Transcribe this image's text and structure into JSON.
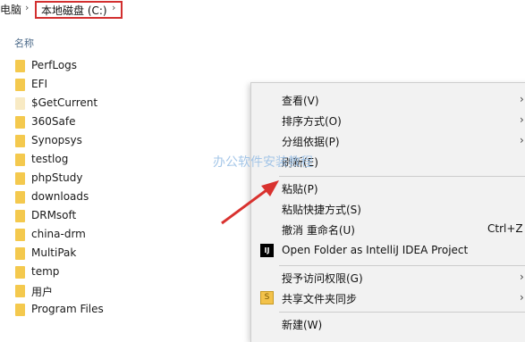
{
  "breadcrumb": {
    "root_label": "电脑",
    "sep1": "›",
    "current_label": "本地磁盘 (C:)",
    "sep2": "›"
  },
  "file_list": {
    "column_header": "名称",
    "items": [
      {
        "label": "PerfLogs",
        "icon": "folder-icon"
      },
      {
        "label": "EFI",
        "icon": "folder-icon"
      },
      {
        "label": "$GetCurrent",
        "icon": "folder-icon-light"
      },
      {
        "label": "360Safe",
        "icon": "folder-icon"
      },
      {
        "label": "Synopsys",
        "icon": "folder-icon"
      },
      {
        "label": "testlog",
        "icon": "folder-icon"
      },
      {
        "label": "phpStudy",
        "icon": "folder-icon"
      },
      {
        "label": "downloads",
        "icon": "folder-icon"
      },
      {
        "label": "DRMsoft",
        "icon": "folder-icon"
      },
      {
        "label": "china-drm",
        "icon": "folder-icon"
      },
      {
        "label": "MultiPak",
        "icon": "folder-icon"
      },
      {
        "label": "temp",
        "icon": "folder-icon"
      },
      {
        "label": "用户",
        "icon": "folder-icon"
      },
      {
        "label": "Program Files",
        "icon": "folder-icon"
      }
    ]
  },
  "context_menu": {
    "view": {
      "label": "查看(V)",
      "arrow": "›"
    },
    "sort": {
      "label": "排序方式(O)",
      "arrow": "›"
    },
    "group": {
      "label": "分组依据(P)",
      "arrow": "›"
    },
    "refresh": {
      "label": "刷新(E)"
    },
    "paste": {
      "label": "粘贴(P)"
    },
    "paste_shortcut": {
      "label": "粘贴快捷方式(S)"
    },
    "undo_rename": {
      "label": "撤消 重命名(U)",
      "shortcut": "Ctrl+Z"
    },
    "open_idea": {
      "label": "Open Folder as IntelliJ IDEA Project",
      "icon_text": "IJ"
    },
    "grant_access": {
      "label": "授予访问权限(G)",
      "arrow": "›"
    },
    "sync_share": {
      "label": "共享文件夹同步",
      "icon_text": "S",
      "arrow": "›"
    },
    "new": {
      "label": "新建(W)"
    }
  },
  "watermark": {
    "text": "办公软件安装教程"
  },
  "colors": {
    "highlight_border": "#d22f2f",
    "arrow": "#d9322f",
    "folder": "#f4c94e",
    "menu_bg": "#f2f2f2"
  }
}
